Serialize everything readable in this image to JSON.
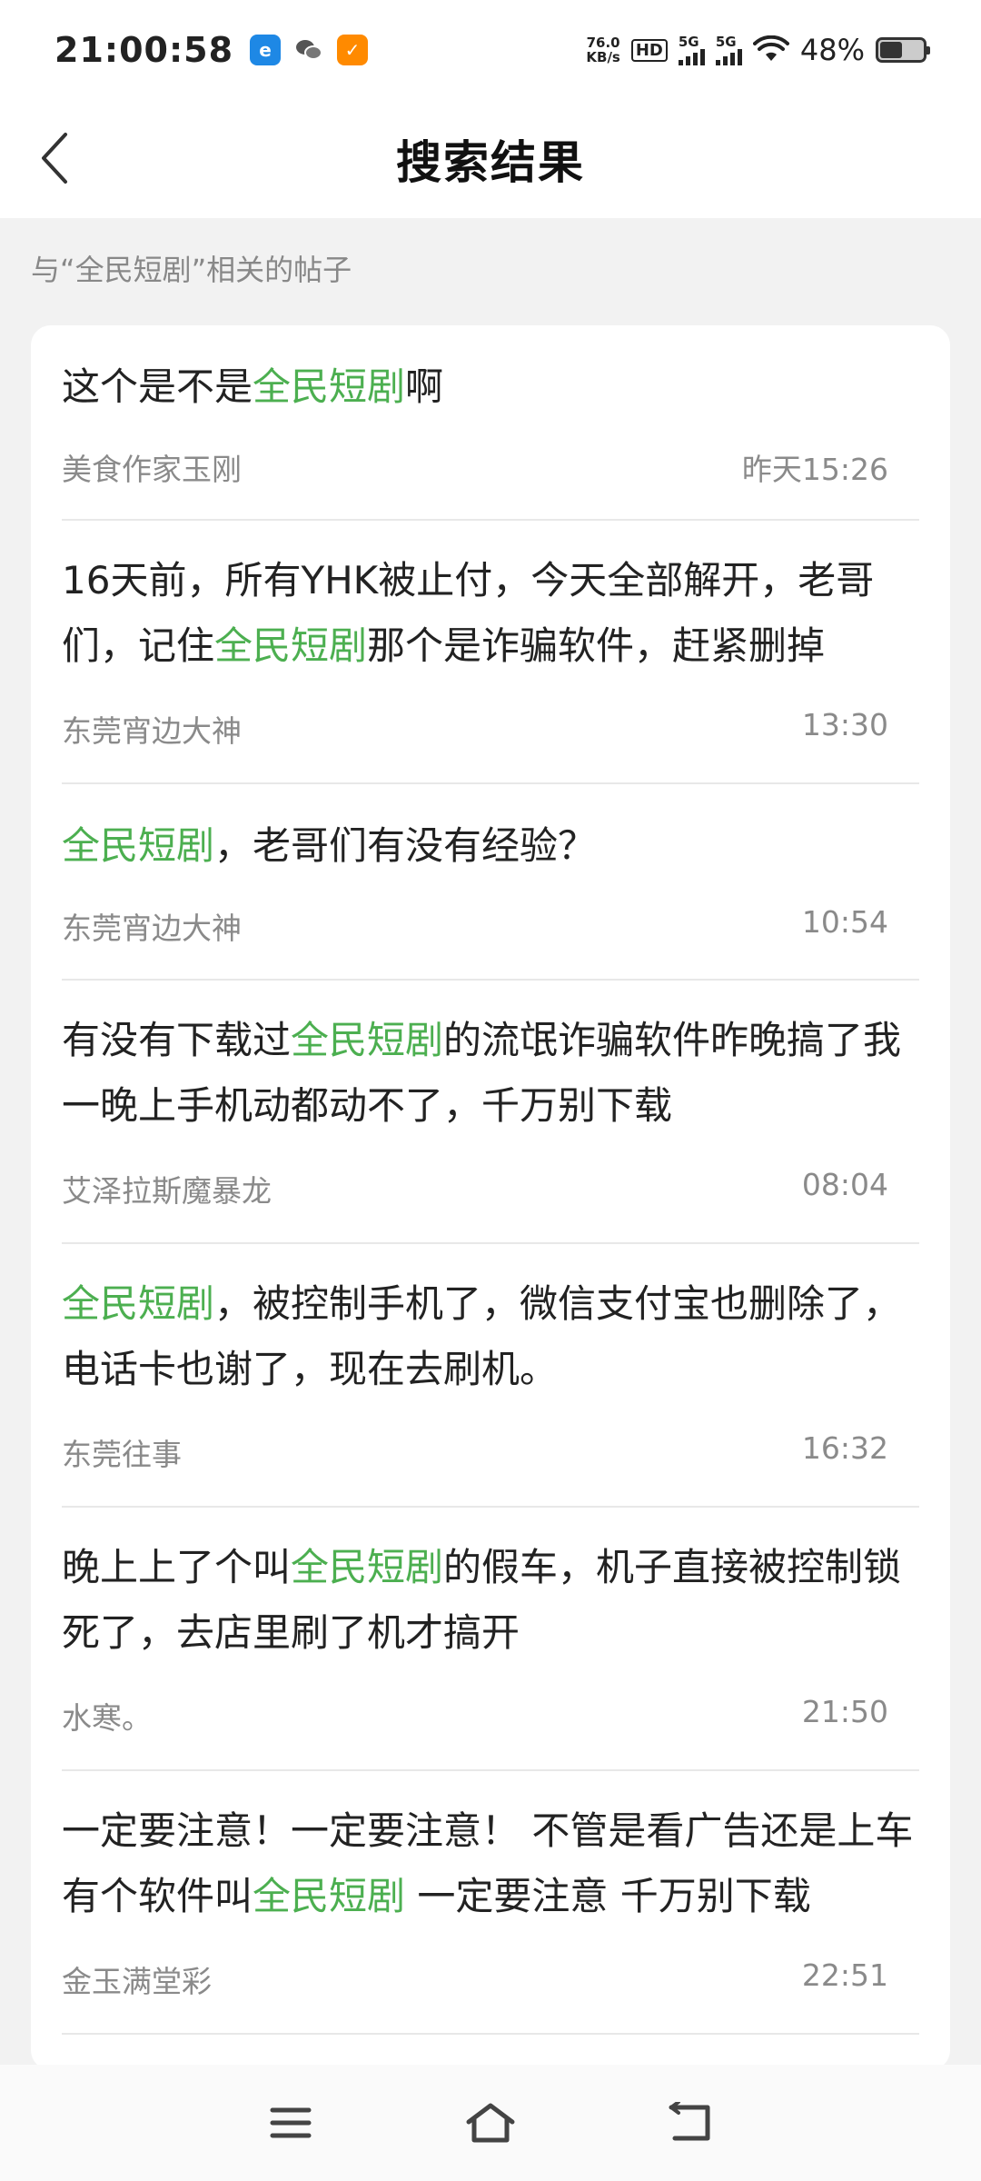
{
  "status": {
    "time": "21:00:58",
    "speed_value": "76.0",
    "speed_unit": "KB/s",
    "hd": "HD",
    "net1": "5G",
    "net2": "5G",
    "battery": "48%"
  },
  "header": {
    "title": "搜索结果"
  },
  "section_label": "与“全民短剧”相关的帖子",
  "posts": [
    {
      "before": "这个是不是",
      "highlight": "全民短剧",
      "after": "啊",
      "author": "美食作家玉刚",
      "time": "昨天15:26"
    },
    {
      "before": "16天前，所有YHK被止付，今天全部解开，老哥们，记住",
      "highlight": "全民短剧",
      "after": "那个是诈骗软件，赶紧删掉",
      "author": "东莞宵边大神",
      "time": "13:30"
    },
    {
      "before": "",
      "highlight": "全民短剧",
      "after": "，老哥们有没有经验？",
      "author": "东莞宵边大神",
      "time": "10:54"
    },
    {
      "before": "有没有下载过",
      "highlight": "全民短剧",
      "after": "的流氓诈骗软件昨晚搞了我一晚上手机动都动不了，千万别下载",
      "author": "艾泽拉斯魔暴龙",
      "time": "08:04"
    },
    {
      "before": "",
      "highlight": "全民短剧",
      "after": "，被控制手机了，微信支付宝也删除了，电话卡也谢了，现在去刷机。",
      "author": "东莞往事",
      "time": "16:32"
    },
    {
      "before": "晚上上了个叫",
      "highlight": "全民短剧",
      "after": "的假车，机子直接被控制锁死了，去店里刷了机才搞开",
      "author": "水寒。",
      "time": "21:50"
    },
    {
      "before": "一定要注意！一定要注意！ 不管是看广告还是上车 有个软件叫",
      "highlight": "全民短剧",
      "after": " 一定要注意 千万别下载",
      "author": "金玉满堂彩",
      "time": "22:51"
    }
  ],
  "colors": {
    "highlight": "#4caf50",
    "meta": "#8a8a8a",
    "background": "#f2f2f2"
  }
}
